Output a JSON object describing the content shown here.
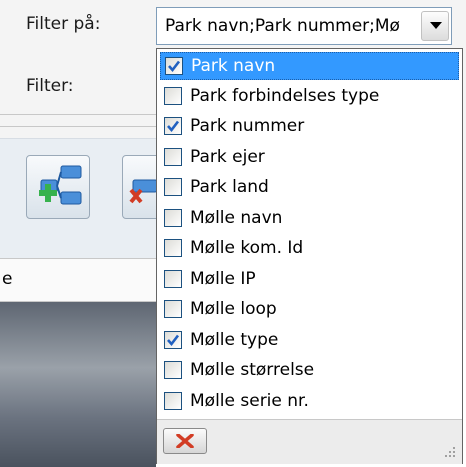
{
  "form": {
    "filter_on_label": "Filter på:",
    "filter_label": "Filter:",
    "left_strip_text": "e"
  },
  "combo": {
    "value": "Park navn;Park nummer;Mø",
    "button_icon": "chevron-down-icon"
  },
  "toolbar": {
    "button1_icon": "add-hierarchy-icon",
    "button2_icon": "delete-hierarchy-icon"
  },
  "dropdown": {
    "items": [
      {
        "label": "Park navn",
        "checked": true,
        "selected": true
      },
      {
        "label": "Park forbindelses type",
        "checked": false,
        "selected": false
      },
      {
        "label": "Park nummer",
        "checked": true,
        "selected": false
      },
      {
        "label": "Park ejer",
        "checked": false,
        "selected": false
      },
      {
        "label": "Park land",
        "checked": false,
        "selected": false
      },
      {
        "label": "Mølle navn",
        "checked": false,
        "selected": false
      },
      {
        "label": "Mølle kom. Id",
        "checked": false,
        "selected": false
      },
      {
        "label": "Mølle IP",
        "checked": false,
        "selected": false
      },
      {
        "label": "Mølle loop",
        "checked": false,
        "selected": false
      },
      {
        "label": "Mølle type",
        "checked": true,
        "selected": false
      },
      {
        "label": "Mølle størrelse",
        "checked": false,
        "selected": false
      },
      {
        "label": "Mølle serie nr.",
        "checked": false,
        "selected": false
      }
    ],
    "close_icon": "close-icon",
    "resize_icon": "resize-grip-icon"
  },
  "colors": {
    "selection": "#3399ff",
    "check": "#2060c0",
    "close_red": "#d23c24"
  }
}
